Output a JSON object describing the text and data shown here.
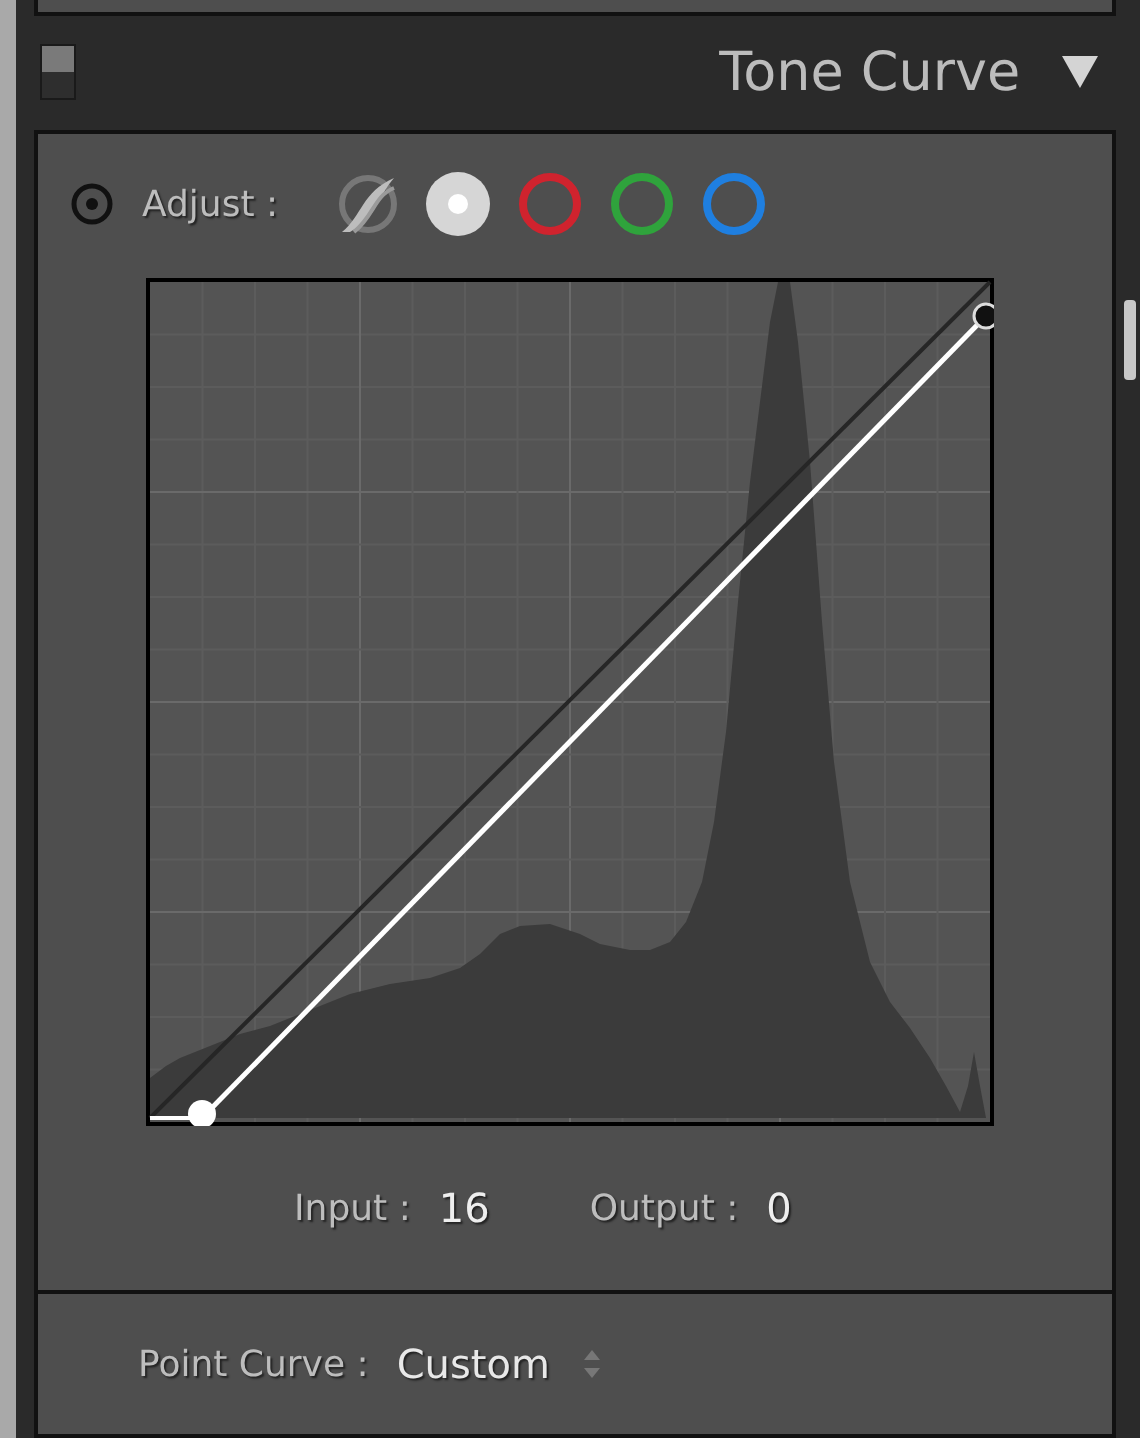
{
  "panel": {
    "title": "Tone Curve",
    "expanded": true,
    "enabled": true
  },
  "adjust": {
    "label": "Adjust :",
    "channels": [
      {
        "kind": "parametric",
        "selected": false
      },
      {
        "kind": "rgb",
        "selected": true
      },
      {
        "kind": "color",
        "color": "#d0232e",
        "selected": false
      },
      {
        "kind": "color",
        "color": "#2fa33c",
        "selected": false
      },
      {
        "kind": "color",
        "color": "#1f7fe0",
        "selected": false
      }
    ]
  },
  "readout": {
    "input_label": "Input :",
    "input_value": "16",
    "output_label": "Output :",
    "output_value": "0"
  },
  "point_curve": {
    "label": "Point Curve :",
    "value": "Custom"
  }
}
